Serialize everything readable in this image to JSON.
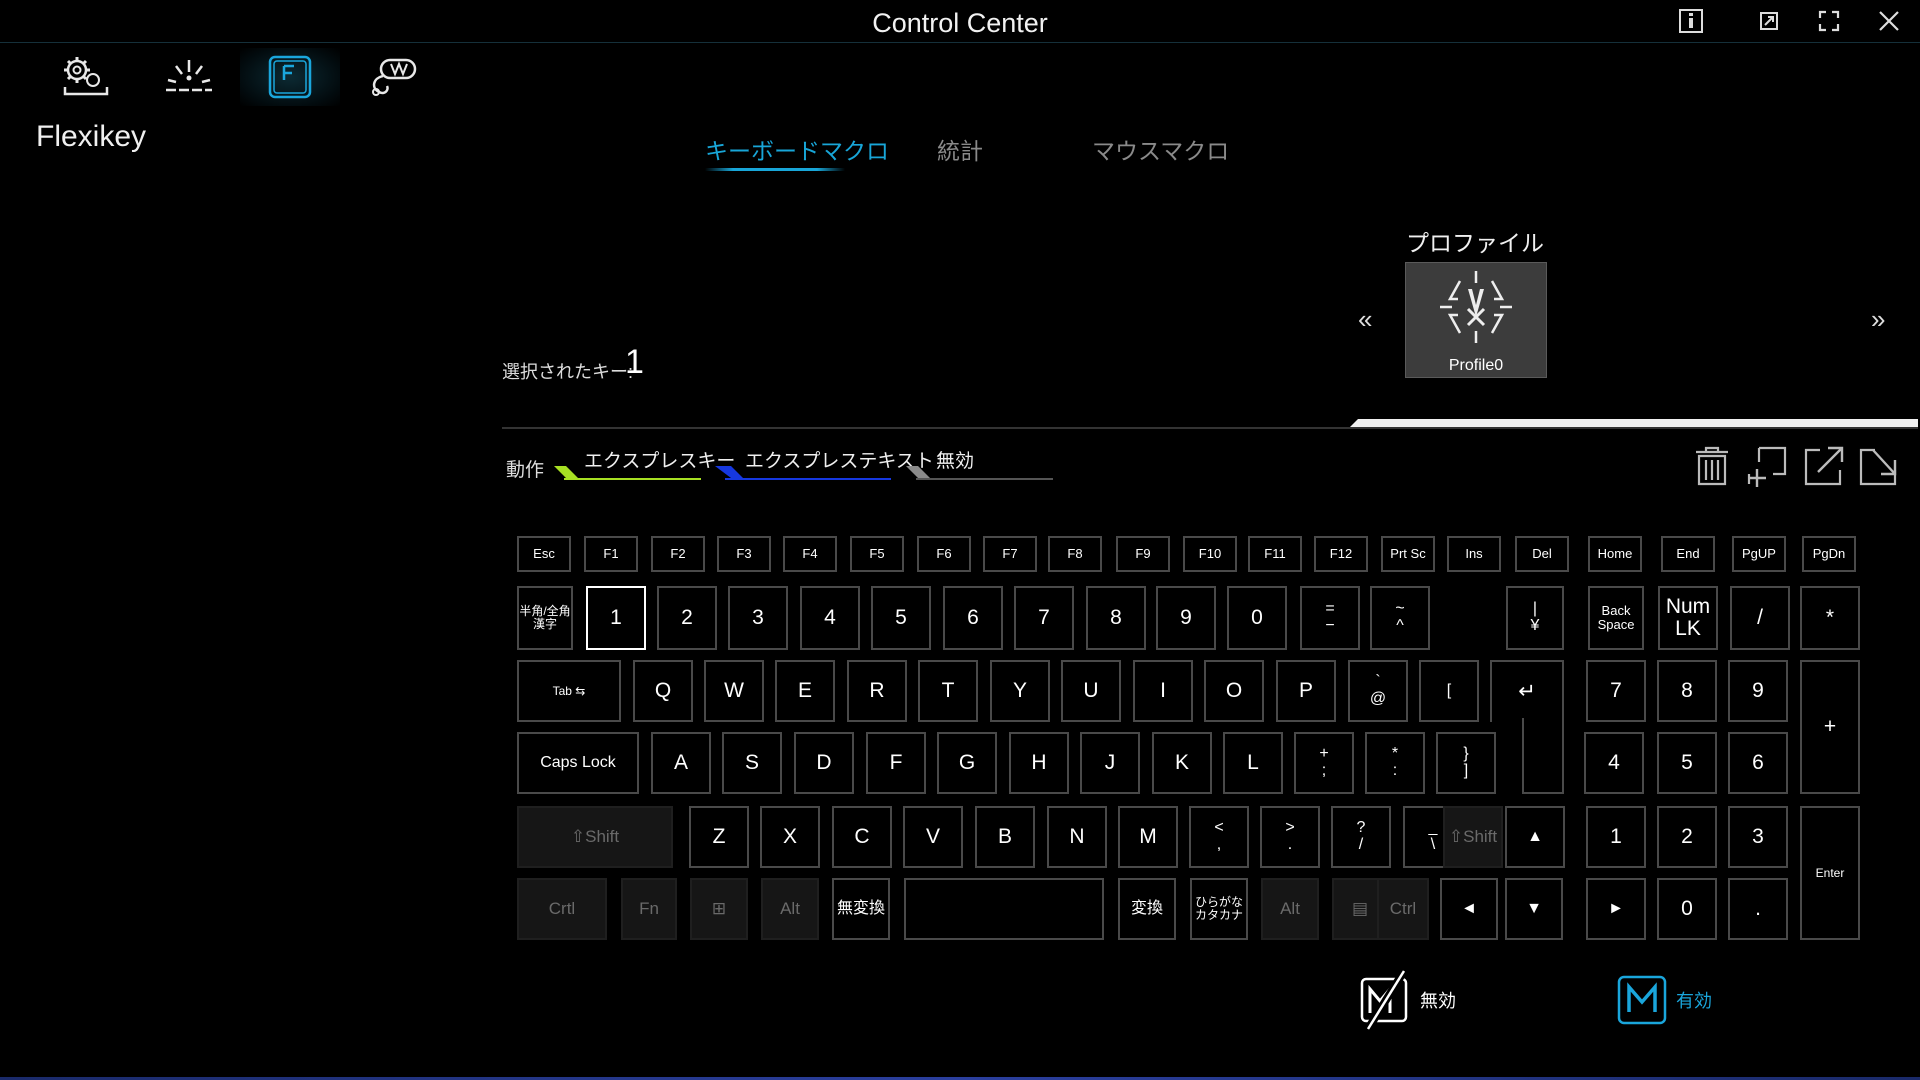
{
  "window": {
    "title": "Control Center"
  },
  "nav": {
    "items": [
      "settings",
      "lighting",
      "flexikey",
      "mouse"
    ]
  },
  "page": {
    "title": "Flexikey"
  },
  "tabs": [
    {
      "label": "キーボードマクロ",
      "active": true
    },
    {
      "label": "統計",
      "active": false
    },
    {
      "label": "マウスマクロ",
      "active": false
    }
  ],
  "profile": {
    "heading": "プロファイル",
    "name": "Profile0",
    "prev": "«",
    "next": "»"
  },
  "selected_key": {
    "label": "選択されたキー:",
    "value": "1"
  },
  "actions": {
    "label": "動作",
    "items": [
      {
        "label": "エクスプレスキー",
        "color": "#a7e023"
      },
      {
        "label": "エクスプレステキスト",
        "color": "#1638e0"
      },
      {
        "label": "無効",
        "color": "#8a8a8a"
      }
    ]
  },
  "tools": [
    "trash-icon",
    "add-icon",
    "export-icon",
    "import-icon"
  ],
  "keyboard": {
    "fn_row": [
      "Esc",
      "F1",
      "F2",
      "F3",
      "F4",
      "F5",
      "F6",
      "F7",
      "F8",
      "F9",
      "F10",
      "F11",
      "F12",
      "Prt Sc",
      "Ins",
      "Del",
      "Home",
      "End",
      "PgUP",
      "PgDn"
    ],
    "num_row": [
      "半角/全角\n漢字",
      "1",
      "2",
      "3",
      "4",
      "5",
      "6",
      "7",
      "8",
      "9",
      "0",
      "=\n−",
      "~\n^",
      "|\n¥",
      "Back\nSpace",
      "Num LK",
      "/",
      "*",
      "-"
    ],
    "q_row": [
      "Tab ⇆",
      "Q",
      "W",
      "E",
      "R",
      "T",
      "Y",
      "U",
      "I",
      "O",
      "P",
      "`\n@",
      "[",
      "↵",
      "7",
      "8",
      "9",
      "+"
    ],
    "a_row": [
      "Caps Lock",
      "A",
      "S",
      "D",
      "F",
      "G",
      "H",
      "J",
      "K",
      "L",
      "+\n;",
      "*\n:",
      "}\n]",
      "4",
      "5",
      "6"
    ],
    "z_row": [
      "⇧Shift",
      "Z",
      "X",
      "C",
      "V",
      "B",
      "N",
      "M",
      "<\n,",
      ">\n.",
      "?\n/",
      "_\n\\",
      "⇧Shift",
      "▲",
      "1",
      "2",
      "3",
      "Enter"
    ],
    "bottom_row": [
      "Crtl",
      "Fn",
      "⊞",
      "Alt",
      "無変換",
      "",
      "変換",
      "ひらがな\nカタカナ",
      "Alt",
      "▤",
      "Ctrl",
      "◄",
      "▼",
      "►",
      "0",
      "."
    ]
  },
  "toggles": [
    {
      "label": "無効",
      "icon": "macro-off-icon",
      "color": "#ffffff"
    },
    {
      "label": "有効",
      "icon": "macro-on-icon",
      "color": "#1aa6dc"
    }
  ],
  "colors": {
    "accent": "#18a6d8",
    "background": "#000000"
  }
}
